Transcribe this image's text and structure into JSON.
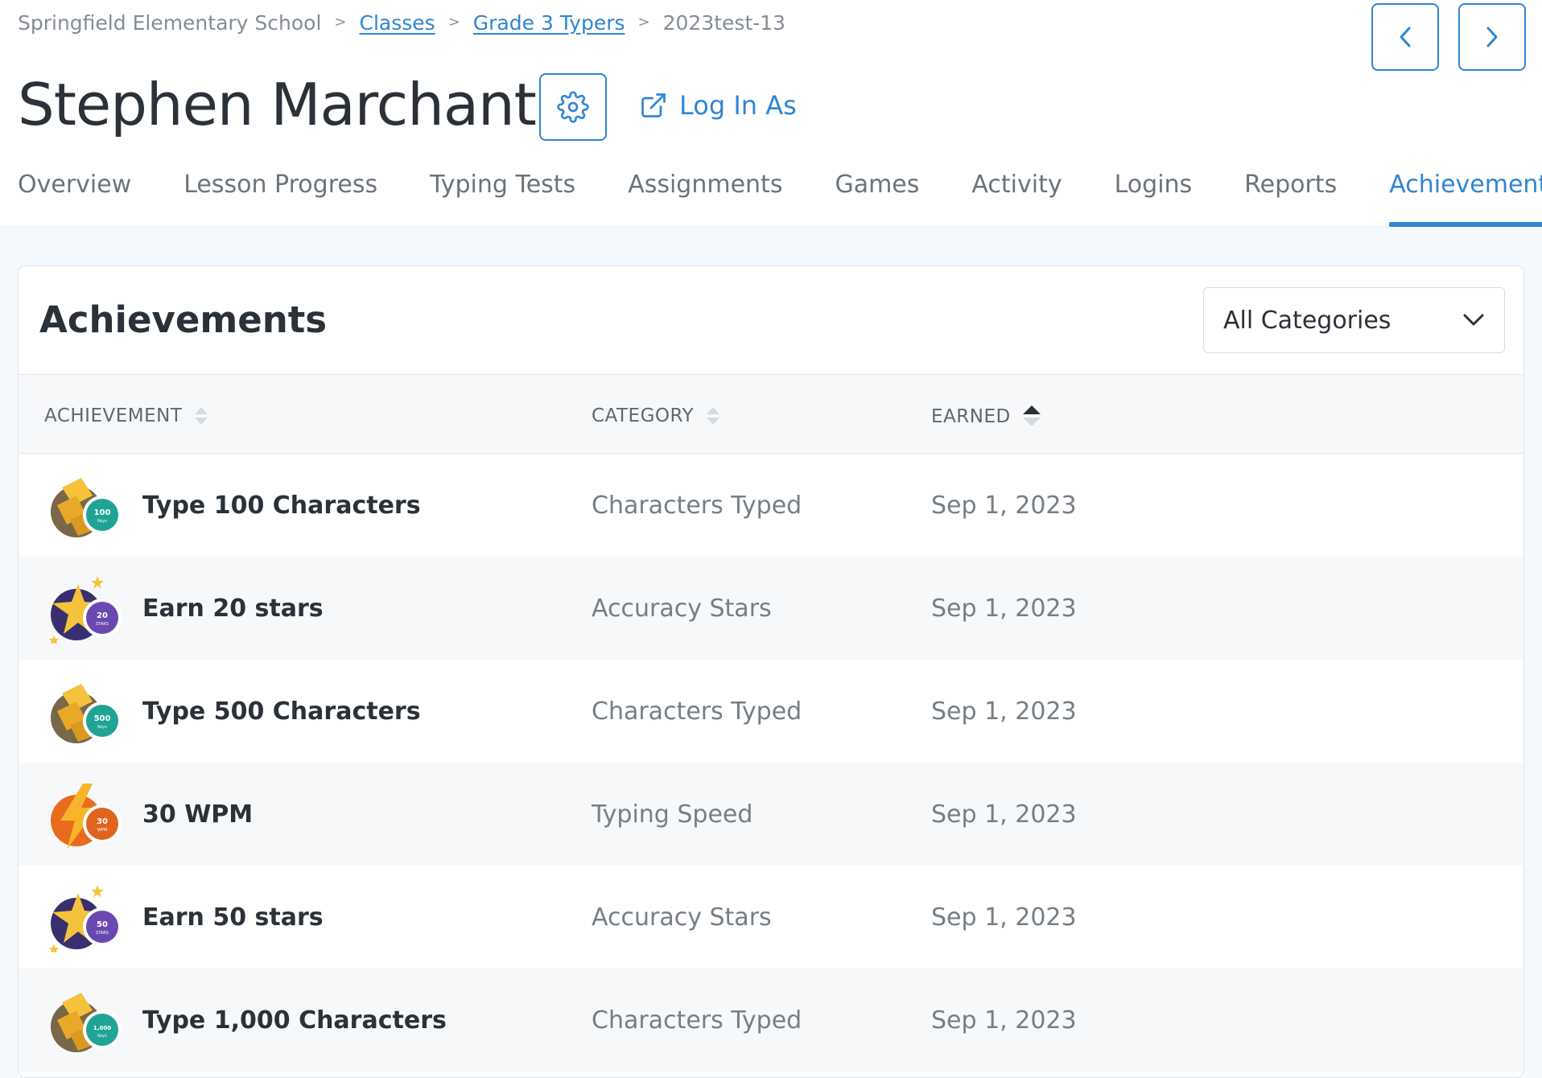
{
  "breadcrumb": {
    "school": "Springfield Elementary School",
    "classes": "Classes",
    "class_name": "Grade 3 Typers",
    "student_id": "2023test-13"
  },
  "student_name": "Stephen Marchant",
  "login_as_label": "Log In As",
  "tabs": [
    {
      "label": "Overview"
    },
    {
      "label": "Lesson Progress"
    },
    {
      "label": "Typing Tests"
    },
    {
      "label": "Assignments"
    },
    {
      "label": "Games"
    },
    {
      "label": "Activity"
    },
    {
      "label": "Logins"
    },
    {
      "label": "Reports"
    },
    {
      "label": "Achievements",
      "active": true
    }
  ],
  "panel": {
    "title": "Achievements",
    "filter_selected": "All Categories"
  },
  "table": {
    "headers": [
      "ACHIEVEMENT",
      "CATEGORY",
      "EARNED"
    ],
    "rows": [
      {
        "name": "Type 100 Characters",
        "category": "Characters Typed",
        "earned": "Sep 1, 2023",
        "badge_top": "100",
        "badge_bottom": "Keys",
        "badge_type": "keys"
      },
      {
        "name": "Earn 20 stars",
        "category": "Accuracy Stars",
        "earned": "Sep 1, 2023",
        "badge_top": "20",
        "badge_bottom": "STARS",
        "badge_type": "stars"
      },
      {
        "name": "Type 500 Characters",
        "category": "Characters Typed",
        "earned": "Sep 1, 2023",
        "badge_top": "500",
        "badge_bottom": "Keys",
        "badge_type": "keys"
      },
      {
        "name": "30 WPM",
        "category": "Typing Speed",
        "earned": "Sep 1, 2023",
        "badge_top": "30",
        "badge_bottom": "WPM",
        "badge_type": "speed"
      },
      {
        "name": "Earn 50 stars",
        "category": "Accuracy Stars",
        "earned": "Sep 1, 2023",
        "badge_top": "50",
        "badge_bottom": "STARS",
        "badge_type": "stars"
      },
      {
        "name": "Type 1,000 Characters",
        "category": "Characters Typed",
        "earned": "Sep 1, 2023",
        "badge_top": "1,000",
        "badge_bottom": "Keys",
        "badge_type": "keys"
      }
    ]
  },
  "colors": {
    "accent": "#2f86d0",
    "keys_badge": "#1fa394",
    "stars_badge": "#6a48b0",
    "speed_badge": "#e0641c"
  }
}
